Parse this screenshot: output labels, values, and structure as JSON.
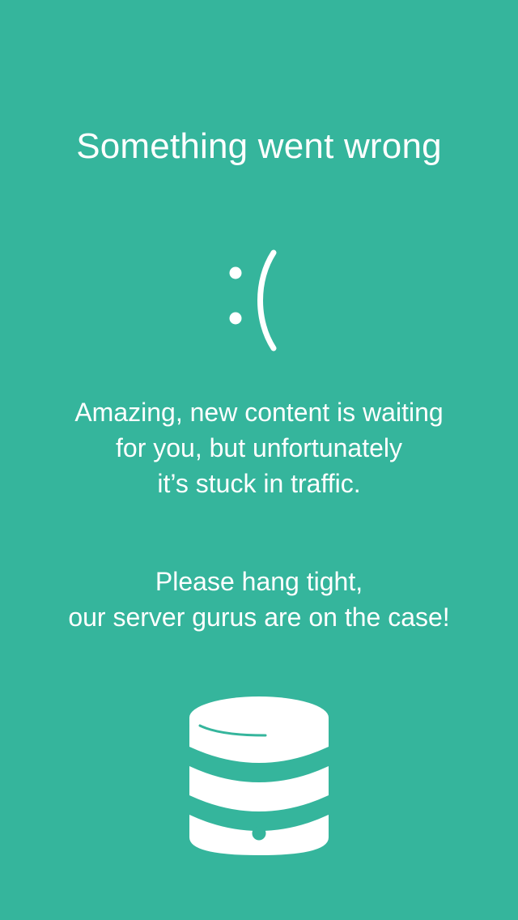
{
  "screen": {
    "title": "Something went wrong",
    "face_icon": "sad-face-emoticon",
    "message_primary": [
      "Amazing, new content is waiting",
      "for you, but unfortunately",
      "it’s stuck in traffic."
    ],
    "message_secondary": [
      "Please hang tight,",
      "our server gurus are on the case!"
    ],
    "server_icon": "database-server-icon",
    "background_color": "#35b59c",
    "foreground_color": "#ffffff"
  }
}
